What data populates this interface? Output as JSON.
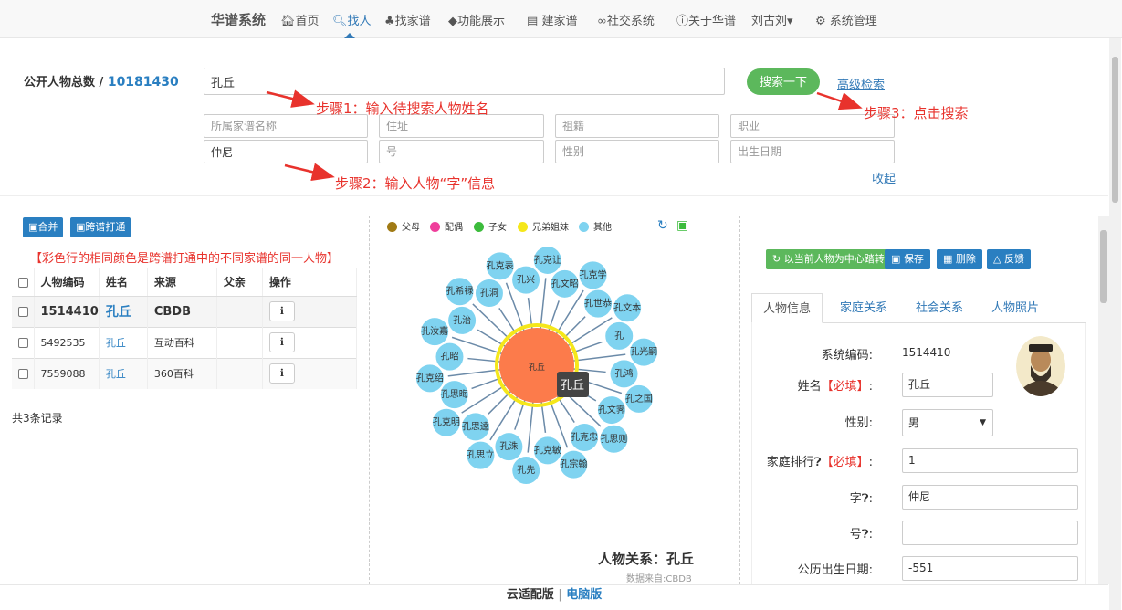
{
  "nav": {
    "brand": "华谱系统",
    "items": [
      {
        "label": "首页",
        "icon": "home-icon"
      },
      {
        "label": "找人",
        "icon": "search-icon"
      },
      {
        "label": "找家谱",
        "icon": "tree-icon"
      },
      {
        "label": "功能展示",
        "icon": "tag-icon"
      },
      {
        "label": "建家谱",
        "icon": "book-icon"
      },
      {
        "label": "社交系统",
        "icon": "link-icon"
      },
      {
        "label": "关于华谱",
        "icon": "info-icon"
      },
      {
        "label": "刘古刘",
        "icon": "caret-down-icon"
      },
      {
        "label": "系统管理",
        "icon": "gears-icon"
      }
    ]
  },
  "search": {
    "total_label": "公开人物总数",
    "total_sep": "/",
    "total_value": "10181430",
    "name_value": "孔丘",
    "fields": [
      {
        "placeholder": "所属家谱名称",
        "value": ""
      },
      {
        "placeholder": "住址",
        "value": ""
      },
      {
        "placeholder": "祖籍",
        "value": ""
      },
      {
        "placeholder": "职业",
        "value": ""
      },
      {
        "placeholder": "",
        "value": "仲尼"
      },
      {
        "placeholder": "号",
        "value": ""
      },
      {
        "placeholder": "性别",
        "value": ""
      },
      {
        "placeholder": "出生日期",
        "value": ""
      }
    ],
    "search_button": "搜索一下",
    "advanced_link": "高级检索",
    "collapse_link": "收起"
  },
  "annotations": {
    "step1": "步骤1：输入待搜索人物姓名",
    "step2": "步骤2：输入人物“字”信息",
    "step3": "步骤3：点击搜索",
    "color": "#e8322c"
  },
  "results": {
    "merge_button": "合并",
    "cross_button": "跨谱打通",
    "note": "【彩色行的相同颜色是跨谱打通中的不同家谱的同一人物】",
    "columns": [
      "人物编码",
      "姓名",
      "来源",
      "父亲",
      "操作"
    ],
    "rows": [
      {
        "code": "1514410",
        "name": "孔丘",
        "source": "CBDB",
        "father": ""
      },
      {
        "code": "5492535",
        "name": "孔丘",
        "source": "互动百科",
        "father": ""
      },
      {
        "code": "7559088",
        "name": "孔丘",
        "source": "360百科",
        "father": ""
      }
    ],
    "count_text": "共3条记录"
  },
  "graph": {
    "legend": [
      {
        "label": "父母",
        "color": "#a07a14"
      },
      {
        "label": "配偶",
        "color": "#ef3e9b"
      },
      {
        "label": "子女",
        "color": "#3cbc3c"
      },
      {
        "label": "兄弟姐妹",
        "color": "#f5e71a"
      },
      {
        "label": "其他",
        "color": "#7fd3f0"
      }
    ],
    "center": "孔丘",
    "tooltip": "孔丘",
    "nodes": [
      "孔克让",
      "孔文昭",
      "孔克学",
      "孔世恭",
      "孔文本",
      "孔",
      "孔光嗣",
      "孔鸿",
      "孔之国",
      "孔文霁",
      "孔思则",
      "孔克忠",
      "孔宗翰",
      "孔克敏",
      "孔先",
      "孔洙",
      "孔思立",
      "孔思逵",
      "孔克明",
      "孔思晦",
      "孔克绍",
      "孔昭",
      "孔汝嘉",
      "孔治",
      "孔希禄",
      "孔洞",
      "孔克表",
      "孔兴"
    ],
    "title": "人物关系：孔丘",
    "source": "数据来自:CBDB"
  },
  "detail": {
    "buttons": [
      "以当前人物为中心踏转",
      "保存",
      "删除",
      "反馈"
    ],
    "tabs": [
      "人物信息",
      "家庭关系",
      "社会关系",
      "人物照片"
    ],
    "fields": {
      "sys_code_label": "系统编码:",
      "sys_code_value": "1514410",
      "name_label": "姓名",
      "required_tag": "【必填】",
      "name_value": "孔丘",
      "gender_label": "性别:",
      "gender_value": "男",
      "rank_label": "家庭排行",
      "rank_value": "1",
      "zi_label": "字",
      "zi_value": "仲尼",
      "hao_label": "号",
      "hao_value": "",
      "birth_label": "公历出生日期:",
      "birth_value": "-551"
    }
  },
  "footer": {
    "cloud": "云适配版",
    "sep": "|",
    "pc": "电脑版"
  }
}
